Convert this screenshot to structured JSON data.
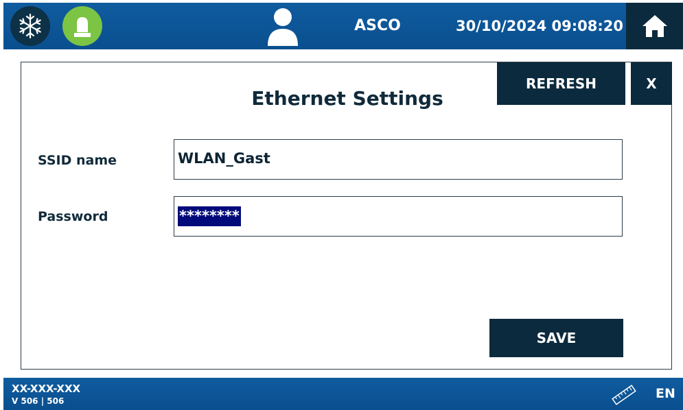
{
  "header": {
    "company": "ASCO",
    "datetime": "30/10/2024 09:08:20",
    "icons": {
      "status_left": "snowflake-icon",
      "status_alarm": "beacon-icon",
      "user": "user-icon",
      "home": "home-icon"
    },
    "colors": {
      "bar": "#0a4f8f",
      "dark_button": "#0c2a3d",
      "alarm_ok": "#7cc444"
    }
  },
  "dialog": {
    "title": "Ethernet Settings",
    "refresh_label": "REFRESH",
    "close_label": "X",
    "fields": {
      "ssid": {
        "label": "SSID name",
        "value": "WLAN_Gast"
      },
      "password": {
        "label": "Password",
        "value": "********"
      }
    },
    "save_label": "SAVE"
  },
  "footer": {
    "device_id": "XX-XXX-XXX",
    "version": "V 506 | 506",
    "language": "EN",
    "icons": {
      "tool": "ruler-icon"
    }
  }
}
